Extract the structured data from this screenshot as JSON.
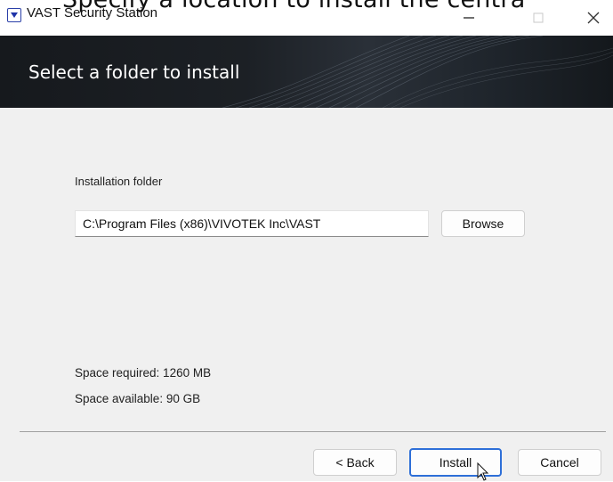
{
  "background_caption": "Specify a location to install the centra",
  "window": {
    "title": "VAST Security Station",
    "icon": "app-logo-icon",
    "controls": [
      "minimize-icon",
      "maximize-icon",
      "close-icon"
    ]
  },
  "banner": {
    "title": "Select a folder to install"
  },
  "form": {
    "folder_label": "Installation folder",
    "folder_value": "C:\\Program Files (x86)\\VIVOTEK Inc\\VAST",
    "browse_label": "Browse",
    "space_required": "Space required: 1260 MB",
    "space_available": "Space available: 90 GB"
  },
  "footer": {
    "back_label": "< Back",
    "install_label": "Install",
    "cancel_label": "Cancel"
  },
  "colors": {
    "banner_bg": "#1c2025",
    "dialog_bg": "#f0f0f0",
    "focus_border": "#2e6fd8"
  }
}
